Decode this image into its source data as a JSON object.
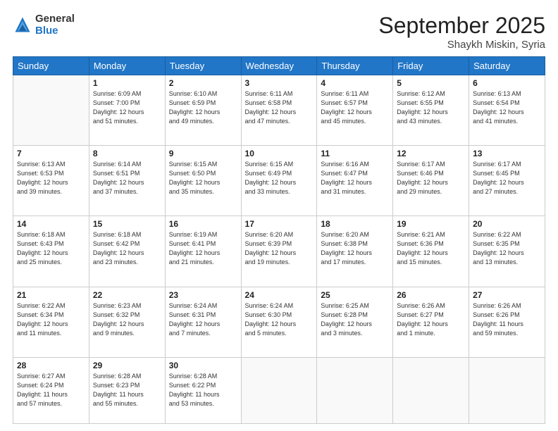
{
  "logo": {
    "general": "General",
    "blue": "Blue"
  },
  "header": {
    "month": "September 2025",
    "location": "Shaykh Miskin, Syria"
  },
  "weekdays": [
    "Sunday",
    "Monday",
    "Tuesday",
    "Wednesday",
    "Thursday",
    "Friday",
    "Saturday"
  ],
  "weeks": [
    [
      {
        "day": "",
        "info": ""
      },
      {
        "day": "1",
        "info": "Sunrise: 6:09 AM\nSunset: 7:00 PM\nDaylight: 12 hours\nand 51 minutes."
      },
      {
        "day": "2",
        "info": "Sunrise: 6:10 AM\nSunset: 6:59 PM\nDaylight: 12 hours\nand 49 minutes."
      },
      {
        "day": "3",
        "info": "Sunrise: 6:11 AM\nSunset: 6:58 PM\nDaylight: 12 hours\nand 47 minutes."
      },
      {
        "day": "4",
        "info": "Sunrise: 6:11 AM\nSunset: 6:57 PM\nDaylight: 12 hours\nand 45 minutes."
      },
      {
        "day": "5",
        "info": "Sunrise: 6:12 AM\nSunset: 6:55 PM\nDaylight: 12 hours\nand 43 minutes."
      },
      {
        "day": "6",
        "info": "Sunrise: 6:13 AM\nSunset: 6:54 PM\nDaylight: 12 hours\nand 41 minutes."
      }
    ],
    [
      {
        "day": "7",
        "info": "Sunrise: 6:13 AM\nSunset: 6:53 PM\nDaylight: 12 hours\nand 39 minutes."
      },
      {
        "day": "8",
        "info": "Sunrise: 6:14 AM\nSunset: 6:51 PM\nDaylight: 12 hours\nand 37 minutes."
      },
      {
        "day": "9",
        "info": "Sunrise: 6:15 AM\nSunset: 6:50 PM\nDaylight: 12 hours\nand 35 minutes."
      },
      {
        "day": "10",
        "info": "Sunrise: 6:15 AM\nSunset: 6:49 PM\nDaylight: 12 hours\nand 33 minutes."
      },
      {
        "day": "11",
        "info": "Sunrise: 6:16 AM\nSunset: 6:47 PM\nDaylight: 12 hours\nand 31 minutes."
      },
      {
        "day": "12",
        "info": "Sunrise: 6:17 AM\nSunset: 6:46 PM\nDaylight: 12 hours\nand 29 minutes."
      },
      {
        "day": "13",
        "info": "Sunrise: 6:17 AM\nSunset: 6:45 PM\nDaylight: 12 hours\nand 27 minutes."
      }
    ],
    [
      {
        "day": "14",
        "info": "Sunrise: 6:18 AM\nSunset: 6:43 PM\nDaylight: 12 hours\nand 25 minutes."
      },
      {
        "day": "15",
        "info": "Sunrise: 6:18 AM\nSunset: 6:42 PM\nDaylight: 12 hours\nand 23 minutes."
      },
      {
        "day": "16",
        "info": "Sunrise: 6:19 AM\nSunset: 6:41 PM\nDaylight: 12 hours\nand 21 minutes."
      },
      {
        "day": "17",
        "info": "Sunrise: 6:20 AM\nSunset: 6:39 PM\nDaylight: 12 hours\nand 19 minutes."
      },
      {
        "day": "18",
        "info": "Sunrise: 6:20 AM\nSunset: 6:38 PM\nDaylight: 12 hours\nand 17 minutes."
      },
      {
        "day": "19",
        "info": "Sunrise: 6:21 AM\nSunset: 6:36 PM\nDaylight: 12 hours\nand 15 minutes."
      },
      {
        "day": "20",
        "info": "Sunrise: 6:22 AM\nSunset: 6:35 PM\nDaylight: 12 hours\nand 13 minutes."
      }
    ],
    [
      {
        "day": "21",
        "info": "Sunrise: 6:22 AM\nSunset: 6:34 PM\nDaylight: 12 hours\nand 11 minutes."
      },
      {
        "day": "22",
        "info": "Sunrise: 6:23 AM\nSunset: 6:32 PM\nDaylight: 12 hours\nand 9 minutes."
      },
      {
        "day": "23",
        "info": "Sunrise: 6:24 AM\nSunset: 6:31 PM\nDaylight: 12 hours\nand 7 minutes."
      },
      {
        "day": "24",
        "info": "Sunrise: 6:24 AM\nSunset: 6:30 PM\nDaylight: 12 hours\nand 5 minutes."
      },
      {
        "day": "25",
        "info": "Sunrise: 6:25 AM\nSunset: 6:28 PM\nDaylight: 12 hours\nand 3 minutes."
      },
      {
        "day": "26",
        "info": "Sunrise: 6:26 AM\nSunset: 6:27 PM\nDaylight: 12 hours\nand 1 minute."
      },
      {
        "day": "27",
        "info": "Sunrise: 6:26 AM\nSunset: 6:26 PM\nDaylight: 11 hours\nand 59 minutes."
      }
    ],
    [
      {
        "day": "28",
        "info": "Sunrise: 6:27 AM\nSunset: 6:24 PM\nDaylight: 11 hours\nand 57 minutes."
      },
      {
        "day": "29",
        "info": "Sunrise: 6:28 AM\nSunset: 6:23 PM\nDaylight: 11 hours\nand 55 minutes."
      },
      {
        "day": "30",
        "info": "Sunrise: 6:28 AM\nSunset: 6:22 PM\nDaylight: 11 hours\nand 53 minutes."
      },
      {
        "day": "",
        "info": ""
      },
      {
        "day": "",
        "info": ""
      },
      {
        "day": "",
        "info": ""
      },
      {
        "day": "",
        "info": ""
      }
    ]
  ]
}
